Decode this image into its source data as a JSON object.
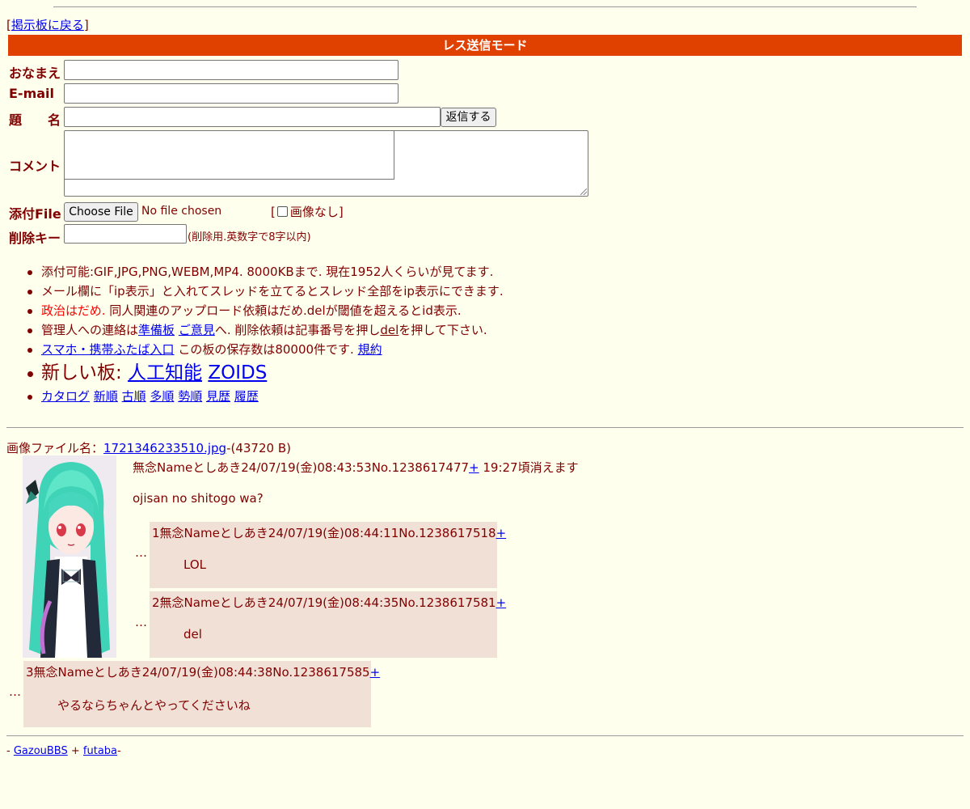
{
  "nav": {
    "back_open": "[",
    "back_link": "掲示板に戻る",
    "back_close": "]"
  },
  "mode_title": "レス送信モード",
  "form": {
    "name_label": "おなまえ",
    "email_label": "E-mail",
    "subject_label": "題　　名",
    "submit_label": "返信する",
    "comment_label": "コメント",
    "file_label": "添付File",
    "choose_file_label": "Choose File",
    "no_file_text": "No file chosen",
    "noimage_open": "[",
    "noimage_label": "画像なし",
    "noimage_close": "]",
    "delkey_label": "削除キー",
    "delkey_note": "(削除用.英数字で8字以内)"
  },
  "rules": {
    "r1": "添付可能:GIF,JPG,PNG,WEBM,MP4. 8000KBまで. 現在1952人くらいが見てます.",
    "r2": "メール欄に「ip表示」と入れてスレッドを立てるとスレッド全部をip表示にできます.",
    "r3_red": "政治はだめ.",
    "r3_rest": " 同人関連のアップロード依頼はだめ.delが閾値を超えるとid表示.",
    "r4_a": "管理人への連絡は",
    "r4_link1": "準備板",
    "r4_sp": " ",
    "r4_link2": "ご意見",
    "r4_b": "へ. 削除依頼は記事番号を押し",
    "r4_del": "del",
    "r4_c": "を押して下さい.",
    "r5_link": "スマホ・携帯ふたば入口",
    "r5_text": " この板の保存数は80000件です. ",
    "r5_link2": "規約",
    "r6_text": "新しい板: ",
    "r6_link1": "人工知能",
    "r6_link2": "ZOIDS",
    "r7_links": [
      "カタログ",
      "新順",
      "古順",
      "多順",
      "勢順",
      "見歴",
      "履歴"
    ]
  },
  "thread": {
    "file_prefix": "画像ファイル名：",
    "file_link": "1721346233510.jpg",
    "file_size": "-(43720 B)",
    "op_header": "無念Nameとしあき24/07/19(金)08:43:53No.1238617477",
    "op_plus": "+",
    "op_expire": " 19:27頃消えます",
    "op_body": "ojisan no shitogo wa?"
  },
  "replies": [
    {
      "header": "1無念Nameとしあき24/07/19(金)08:44:11No.1238617518",
      "plus": "+",
      "body": "LOL",
      "dots": "…"
    },
    {
      "header": "2無念Nameとしあき24/07/19(金)08:44:35No.1238617581",
      "plus": "+",
      "body": "del",
      "dots": "…"
    },
    {
      "header": "3無念Nameとしあき24/07/19(金)08:44:38No.1238617585",
      "plus": "+",
      "body": "やるならちゃんとやってくださいね",
      "dots": "…"
    }
  ],
  "footer": {
    "dash1": "- ",
    "link1": "GazouBBS",
    "plus": " + ",
    "link2": "futaba",
    "dash2": "-"
  },
  "colors": {
    "background": "#FFFFEE",
    "text": "#800000",
    "mode_bar": "#E04000",
    "reply_bg": "#F0E0D6",
    "link": "#0000EE",
    "red": "#FF0000"
  }
}
